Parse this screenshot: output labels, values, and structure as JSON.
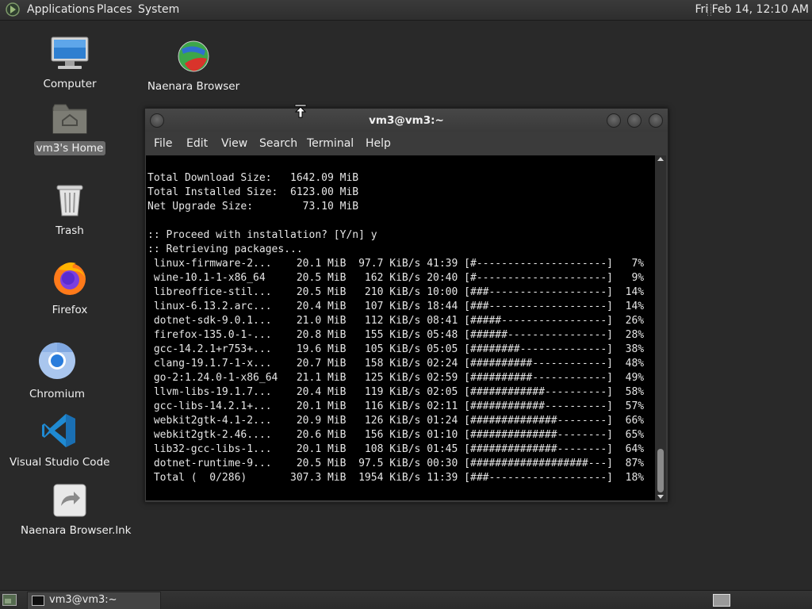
{
  "top_panel": {
    "menus": [
      "Applications",
      "Places",
      "System"
    ],
    "clock": "Fri Feb 14, 12:10 AM"
  },
  "desktop_icons": {
    "computer": "Computer",
    "naenara_browser": "Naenara Browser",
    "home": "vm3's Home",
    "trash": "Trash",
    "firefox": "Firefox",
    "chromium": "Chromium",
    "vscode": "Visual Studio Code",
    "naenara_lnk": "Naenara Browser.lnk"
  },
  "terminal": {
    "title": "vm3@vm3:~",
    "menu": [
      "File",
      "Edit",
      "View",
      "Search",
      "Terminal",
      "Help"
    ],
    "output": "Total Download Size:   1642.09 MiB\nTotal Installed Size:  6123.00 MiB\nNet Upgrade Size:        73.10 MiB\n\n:: Proceed with installation? [Y/n] y\n:: Retrieving packages...\n linux-firmware-2...    20.1 MiB  97.7 KiB/s 41:39 [#---------------------]   7%\n wine-10.1-1-x86_64     20.5 MiB   162 KiB/s 20:40 [#---------------------]   9%\n libreoffice-stil...    20.5 MiB   210 KiB/s 10:00 [###-------------------]  14%\n linux-6.13.2.arc...    20.4 MiB   107 KiB/s 18:44 [###-------------------]  14%\n dotnet-sdk-9.0.1...    21.0 MiB   112 KiB/s 08:41 [#####-----------------]  26%\n firefox-135.0-1-...    20.8 MiB   155 KiB/s 05:48 [######----------------]  28%\n gcc-14.2.1+r753+...    19.6 MiB   105 KiB/s 05:05 [########--------------]  38%\n clang-19.1.7-1-x...    20.7 MiB   158 KiB/s 02:24 [##########------------]  48%\n go-2:1.24.0-1-x86_64   21.1 MiB   125 KiB/s 02:59 [##########------------]  49%\n llvm-libs-19.1.7...    20.4 MiB   119 KiB/s 02:05 [############----------]  58%\n gcc-libs-14.2.1+...    20.1 MiB   116 KiB/s 02:11 [############----------]  57%\n webkit2gtk-4.1-2...    20.9 MiB   126 KiB/s 01:24 [##############--------]  66%\n webkit2gtk-2.46....    20.6 MiB   156 KiB/s 01:10 [##############--------]  65%\n lib32-gcc-libs-1...    20.1 MiB   108 KiB/s 01:45 [##############--------]  64%\n dotnet-runtime-9...    20.5 MiB  97.5 KiB/s 00:30 [###################---]  87%\n Total (  0/286)       307.3 MiB  1954 KiB/s 11:39 [###-------------------]  18%"
  },
  "taskbar": {
    "task_label": "vm3@vm3:~"
  }
}
